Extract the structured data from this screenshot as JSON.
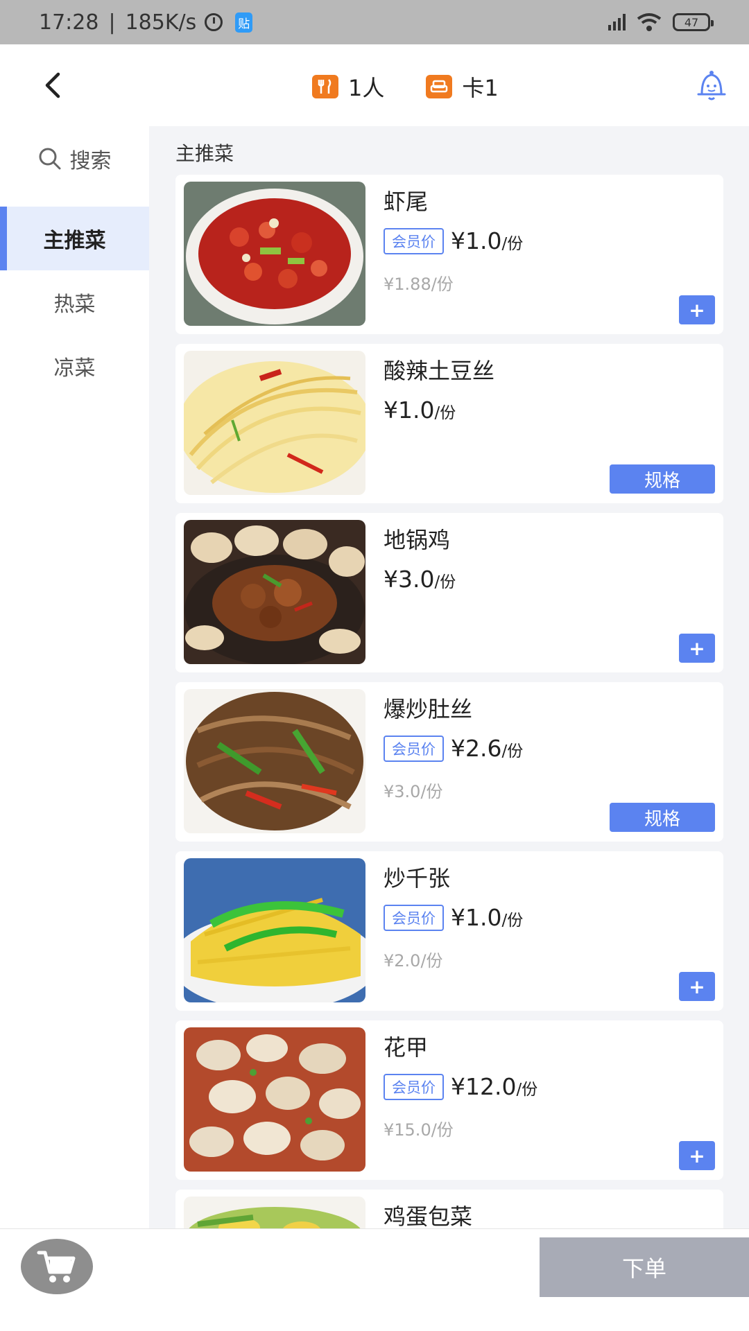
{
  "status_bar": {
    "time": "17:28",
    "separator": "|",
    "speed": "185K/s",
    "notification_badge": "贴",
    "battery": "47"
  },
  "header": {
    "diners": "1人",
    "table": "卡1",
    "icons": [
      "back-icon",
      "cutlery-icon",
      "sofa-icon",
      "bell-icon"
    ]
  },
  "sidebar": {
    "search_label": "搜索",
    "categories": [
      {
        "label": "主推菜",
        "active": true
      },
      {
        "label": "热菜",
        "active": false
      },
      {
        "label": "凉菜",
        "active": false
      }
    ]
  },
  "section": {
    "title": "主推菜"
  },
  "dishes": [
    {
      "name": "虾尾",
      "member_label": "会员价",
      "price": "¥1.0",
      "unit": "/份",
      "original_price": "¥1.88/份",
      "action": "+"
    },
    {
      "name": "酸辣土豆丝",
      "member_label": "",
      "price": "¥1.0",
      "unit": "/份",
      "original_price": "",
      "action": "规格"
    },
    {
      "name": "地锅鸡",
      "member_label": "",
      "price": "¥3.0",
      "unit": "/份",
      "original_price": "",
      "action": "+"
    },
    {
      "name": "爆炒肚丝",
      "member_label": "会员价",
      "price": "¥2.6",
      "unit": "/份",
      "original_price": "¥3.0/份",
      "action": "规格"
    },
    {
      "name": "炒千张",
      "member_label": "会员价",
      "price": "¥1.0",
      "unit": "/份",
      "original_price": "¥2.0/份",
      "action": "+"
    },
    {
      "name": "花甲",
      "member_label": "会员价",
      "price": "¥12.0",
      "unit": "/份",
      "original_price": "¥15.0/份",
      "action": "+"
    },
    {
      "name": "鸡蛋包菜",
      "member_label": "",
      "price": "",
      "unit": "",
      "original_price": "",
      "action": ""
    }
  ],
  "bottom_bar": {
    "order_label": "下单"
  },
  "colors": {
    "accent": "#5b83f0",
    "orange": "#f07a1f",
    "disabled_button": "#a8abb6"
  }
}
